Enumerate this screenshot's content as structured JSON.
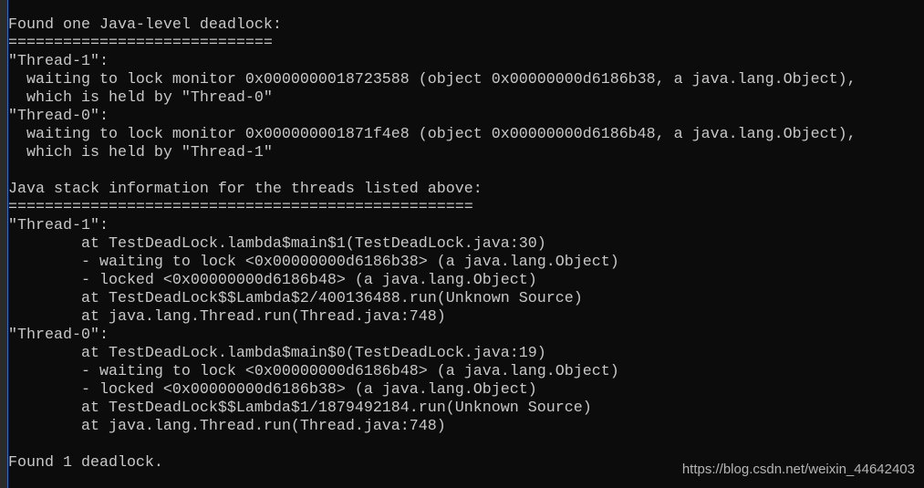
{
  "terminal": {
    "lines": [
      "Found one Java-level deadlock:",
      "=============================",
      "\"Thread-1\":",
      "  waiting to lock monitor 0x0000000018723588 (object 0x00000000d6186b38, a java.lang.Object),",
      "  which is held by \"Thread-0\"",
      "\"Thread-0\":",
      "  waiting to lock monitor 0x000000001871f4e8 (object 0x00000000d6186b48, a java.lang.Object),",
      "  which is held by \"Thread-1\"",
      "",
      "Java stack information for the threads listed above:",
      "===================================================",
      "\"Thread-1\":",
      "        at TestDeadLock.lambda$main$1(TestDeadLock.java:30)",
      "        - waiting to lock <0x00000000d6186b38> (a java.lang.Object)",
      "        - locked <0x00000000d6186b48> (a java.lang.Object)",
      "        at TestDeadLock$$Lambda$2/400136488.run(Unknown Source)",
      "        at java.lang.Thread.run(Thread.java:748)",
      "\"Thread-0\":",
      "        at TestDeadLock.lambda$main$0(TestDeadLock.java:19)",
      "        - waiting to lock <0x00000000d6186b48> (a java.lang.Object)",
      "        - locked <0x00000000d6186b38> (a java.lang.Object)",
      "        at TestDeadLock$$Lambda$1/1879492184.run(Unknown Source)",
      "        at java.lang.Thread.run(Thread.java:748)",
      "",
      "Found 1 deadlock."
    ]
  },
  "watermark": "https://blog.csdn.net/weixin_44642403"
}
